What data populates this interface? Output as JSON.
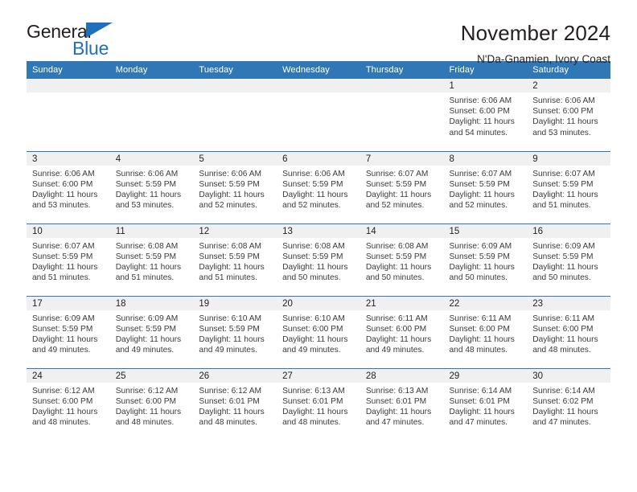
{
  "brand": {
    "name_part1": "General",
    "name_part2": "Blue",
    "logo_icon": "triangle-logo-icon",
    "accent_color": "#1f6fbb"
  },
  "header": {
    "title": "November 2024",
    "subtitle": "N'Da-Gnamien, Ivory Coast"
  },
  "calendar": {
    "header_color": "#3077b6",
    "daynum_band_color": "#f0f0f0",
    "weekday_headers": [
      "Sunday",
      "Monday",
      "Tuesday",
      "Wednesday",
      "Thursday",
      "Friday",
      "Saturday"
    ],
    "weeks": [
      [
        {
          "day": "",
          "blank": true,
          "sunrise": "",
          "sunset": "",
          "daylight_1": "",
          "daylight_2": ""
        },
        {
          "day": "",
          "blank": true,
          "sunrise": "",
          "sunset": "",
          "daylight_1": "",
          "daylight_2": ""
        },
        {
          "day": "",
          "blank": true,
          "sunrise": "",
          "sunset": "",
          "daylight_1": "",
          "daylight_2": ""
        },
        {
          "day": "",
          "blank": true,
          "sunrise": "",
          "sunset": "",
          "daylight_1": "",
          "daylight_2": ""
        },
        {
          "day": "",
          "blank": true,
          "sunrise": "",
          "sunset": "",
          "daylight_1": "",
          "daylight_2": ""
        },
        {
          "day": "1",
          "blank": false,
          "sunrise": "Sunrise: 6:06 AM",
          "sunset": "Sunset: 6:00 PM",
          "daylight_1": "Daylight: 11 hours",
          "daylight_2": "and 54 minutes."
        },
        {
          "day": "2",
          "blank": false,
          "sunrise": "Sunrise: 6:06 AM",
          "sunset": "Sunset: 6:00 PM",
          "daylight_1": "Daylight: 11 hours",
          "daylight_2": "and 53 minutes."
        }
      ],
      [
        {
          "day": "3",
          "blank": false,
          "sunrise": "Sunrise: 6:06 AM",
          "sunset": "Sunset: 6:00 PM",
          "daylight_1": "Daylight: 11 hours",
          "daylight_2": "and 53 minutes."
        },
        {
          "day": "4",
          "blank": false,
          "sunrise": "Sunrise: 6:06 AM",
          "sunset": "Sunset: 5:59 PM",
          "daylight_1": "Daylight: 11 hours",
          "daylight_2": "and 53 minutes."
        },
        {
          "day": "5",
          "blank": false,
          "sunrise": "Sunrise: 6:06 AM",
          "sunset": "Sunset: 5:59 PM",
          "daylight_1": "Daylight: 11 hours",
          "daylight_2": "and 52 minutes."
        },
        {
          "day": "6",
          "blank": false,
          "sunrise": "Sunrise: 6:06 AM",
          "sunset": "Sunset: 5:59 PM",
          "daylight_1": "Daylight: 11 hours",
          "daylight_2": "and 52 minutes."
        },
        {
          "day": "7",
          "blank": false,
          "sunrise": "Sunrise: 6:07 AM",
          "sunset": "Sunset: 5:59 PM",
          "daylight_1": "Daylight: 11 hours",
          "daylight_2": "and 52 minutes."
        },
        {
          "day": "8",
          "blank": false,
          "sunrise": "Sunrise: 6:07 AM",
          "sunset": "Sunset: 5:59 PM",
          "daylight_1": "Daylight: 11 hours",
          "daylight_2": "and 52 minutes."
        },
        {
          "day": "9",
          "blank": false,
          "sunrise": "Sunrise: 6:07 AM",
          "sunset": "Sunset: 5:59 PM",
          "daylight_1": "Daylight: 11 hours",
          "daylight_2": "and 51 minutes."
        }
      ],
      [
        {
          "day": "10",
          "blank": false,
          "sunrise": "Sunrise: 6:07 AM",
          "sunset": "Sunset: 5:59 PM",
          "daylight_1": "Daylight: 11 hours",
          "daylight_2": "and 51 minutes."
        },
        {
          "day": "11",
          "blank": false,
          "sunrise": "Sunrise: 6:08 AM",
          "sunset": "Sunset: 5:59 PM",
          "daylight_1": "Daylight: 11 hours",
          "daylight_2": "and 51 minutes."
        },
        {
          "day": "12",
          "blank": false,
          "sunrise": "Sunrise: 6:08 AM",
          "sunset": "Sunset: 5:59 PM",
          "daylight_1": "Daylight: 11 hours",
          "daylight_2": "and 51 minutes."
        },
        {
          "day": "13",
          "blank": false,
          "sunrise": "Sunrise: 6:08 AM",
          "sunset": "Sunset: 5:59 PM",
          "daylight_1": "Daylight: 11 hours",
          "daylight_2": "and 50 minutes."
        },
        {
          "day": "14",
          "blank": false,
          "sunrise": "Sunrise: 6:08 AM",
          "sunset": "Sunset: 5:59 PM",
          "daylight_1": "Daylight: 11 hours",
          "daylight_2": "and 50 minutes."
        },
        {
          "day": "15",
          "blank": false,
          "sunrise": "Sunrise: 6:09 AM",
          "sunset": "Sunset: 5:59 PM",
          "daylight_1": "Daylight: 11 hours",
          "daylight_2": "and 50 minutes."
        },
        {
          "day": "16",
          "blank": false,
          "sunrise": "Sunrise: 6:09 AM",
          "sunset": "Sunset: 5:59 PM",
          "daylight_1": "Daylight: 11 hours",
          "daylight_2": "and 50 minutes."
        }
      ],
      [
        {
          "day": "17",
          "blank": false,
          "sunrise": "Sunrise: 6:09 AM",
          "sunset": "Sunset: 5:59 PM",
          "daylight_1": "Daylight: 11 hours",
          "daylight_2": "and 49 minutes."
        },
        {
          "day": "18",
          "blank": false,
          "sunrise": "Sunrise: 6:09 AM",
          "sunset": "Sunset: 5:59 PM",
          "daylight_1": "Daylight: 11 hours",
          "daylight_2": "and 49 minutes."
        },
        {
          "day": "19",
          "blank": false,
          "sunrise": "Sunrise: 6:10 AM",
          "sunset": "Sunset: 5:59 PM",
          "daylight_1": "Daylight: 11 hours",
          "daylight_2": "and 49 minutes."
        },
        {
          "day": "20",
          "blank": false,
          "sunrise": "Sunrise: 6:10 AM",
          "sunset": "Sunset: 6:00 PM",
          "daylight_1": "Daylight: 11 hours",
          "daylight_2": "and 49 minutes."
        },
        {
          "day": "21",
          "blank": false,
          "sunrise": "Sunrise: 6:11 AM",
          "sunset": "Sunset: 6:00 PM",
          "daylight_1": "Daylight: 11 hours",
          "daylight_2": "and 49 minutes."
        },
        {
          "day": "22",
          "blank": false,
          "sunrise": "Sunrise: 6:11 AM",
          "sunset": "Sunset: 6:00 PM",
          "daylight_1": "Daylight: 11 hours",
          "daylight_2": "and 48 minutes."
        },
        {
          "day": "23",
          "blank": false,
          "sunrise": "Sunrise: 6:11 AM",
          "sunset": "Sunset: 6:00 PM",
          "daylight_1": "Daylight: 11 hours",
          "daylight_2": "and 48 minutes."
        }
      ],
      [
        {
          "day": "24",
          "blank": false,
          "sunrise": "Sunrise: 6:12 AM",
          "sunset": "Sunset: 6:00 PM",
          "daylight_1": "Daylight: 11 hours",
          "daylight_2": "and 48 minutes."
        },
        {
          "day": "25",
          "blank": false,
          "sunrise": "Sunrise: 6:12 AM",
          "sunset": "Sunset: 6:00 PM",
          "daylight_1": "Daylight: 11 hours",
          "daylight_2": "and 48 minutes."
        },
        {
          "day": "26",
          "blank": false,
          "sunrise": "Sunrise: 6:12 AM",
          "sunset": "Sunset: 6:01 PM",
          "daylight_1": "Daylight: 11 hours",
          "daylight_2": "and 48 minutes."
        },
        {
          "day": "27",
          "blank": false,
          "sunrise": "Sunrise: 6:13 AM",
          "sunset": "Sunset: 6:01 PM",
          "daylight_1": "Daylight: 11 hours",
          "daylight_2": "and 48 minutes."
        },
        {
          "day": "28",
          "blank": false,
          "sunrise": "Sunrise: 6:13 AM",
          "sunset": "Sunset: 6:01 PM",
          "daylight_1": "Daylight: 11 hours",
          "daylight_2": "and 47 minutes."
        },
        {
          "day": "29",
          "blank": false,
          "sunrise": "Sunrise: 6:14 AM",
          "sunset": "Sunset: 6:01 PM",
          "daylight_1": "Daylight: 11 hours",
          "daylight_2": "and 47 minutes."
        },
        {
          "day": "30",
          "blank": false,
          "sunrise": "Sunrise: 6:14 AM",
          "sunset": "Sunset: 6:02 PM",
          "daylight_1": "Daylight: 11 hours",
          "daylight_2": "and 47 minutes."
        }
      ]
    ]
  }
}
